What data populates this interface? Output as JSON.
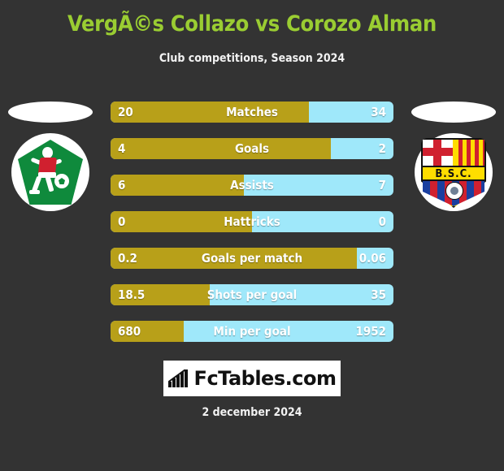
{
  "header": {
    "title": "VergÃ©s Collazo vs Corozo Alman",
    "subtitle": "Club competitions, Season 2024"
  },
  "emblems": {
    "left": {
      "name": "green-pentagon-player-crest",
      "alt": ""
    },
    "right": {
      "name": "barcelona-sc-crest",
      "monogram": "B.S.C."
    }
  },
  "stats": [
    {
      "label": "Matches",
      "left": "20",
      "right": "34",
      "fill_percent": 70
    },
    {
      "label": "Goals",
      "left": "4",
      "right": "2",
      "fill_percent": 78
    },
    {
      "label": "Assists",
      "left": "6",
      "right": "7",
      "fill_percent": 47
    },
    {
      "label": "Hattricks",
      "left": "0",
      "right": "0",
      "fill_percent": 50
    },
    {
      "label": "Goals per match",
      "left": "0.2",
      "right": "0.06",
      "fill_percent": 87
    },
    {
      "label": "Shots per goal",
      "left": "18.5",
      "right": "35",
      "fill_percent": 35
    },
    {
      "label": "Min per goal",
      "left": "680",
      "right": "1952",
      "fill_percent": 26
    }
  ],
  "footer": {
    "logo_text": "FcTables.com",
    "date": "2 december 2024"
  },
  "colors": {
    "background": "#333333",
    "title": "#9acd32",
    "bar_left": "#b8a019",
    "bar_right": "#9fe8fa",
    "text": "#ffffff"
  }
}
